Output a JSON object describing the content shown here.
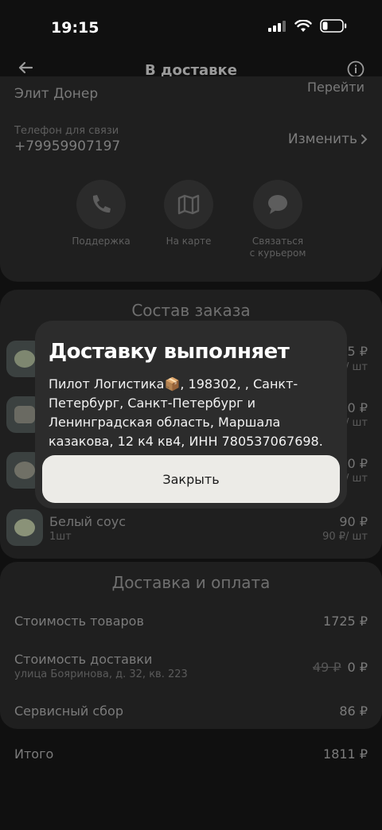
{
  "status_bar": {
    "time": "19:15"
  },
  "header": {
    "title": "В доставке"
  },
  "order": {
    "restaurant": "Элит Донер",
    "restaurant_link": "Перейти",
    "phone_label": "Телефон для связи",
    "phone": "+79959907197",
    "change_label": "Изменить"
  },
  "actions": [
    {
      "label": "Поддержка",
      "icon": "phone-icon"
    },
    {
      "label": "На карте",
      "icon": "map-icon"
    },
    {
      "label": "Связаться\nс курьером",
      "icon": "chat-icon"
    }
  ],
  "composition": {
    "title": "Состав заказа",
    "items": [
      {
        "name": "",
        "qty": "",
        "price": "95 ₽",
        "unit_price": "/ шт"
      },
      {
        "name": "",
        "qty": "",
        "price": "20 ₽",
        "unit_price": "/ шт"
      },
      {
        "name": "",
        "qty": "",
        "price": "20 ₽",
        "unit_price": "/ шт"
      },
      {
        "name": "Белый соус",
        "qty": "1шт",
        "price": "90 ₽",
        "unit_price": "90 ₽/ шт"
      }
    ]
  },
  "payment": {
    "title": "Доставка и оплата",
    "goods_label": "Стоимость товаров",
    "goods_value": "1725 ₽",
    "delivery_label": "Стоимость доставки",
    "delivery_address": "улица Бояринова, д. 32, кв. 223",
    "delivery_old": "49 ₽",
    "delivery_value": "0 ₽",
    "service_label": "Сервисный сбор",
    "service_value": "86 ₽",
    "total_label": "Итого",
    "total_value": "1811 ₽"
  },
  "modal": {
    "title": "Доставку выполняет",
    "text": "Пилот Логистика📦, 198302, , Санкт-Петербург, Санкт-Петербург и Ленинградская область, Маршала казакова, 12 к4 кв4, ИНН 780537067698.",
    "close_label": "Закрыть"
  }
}
